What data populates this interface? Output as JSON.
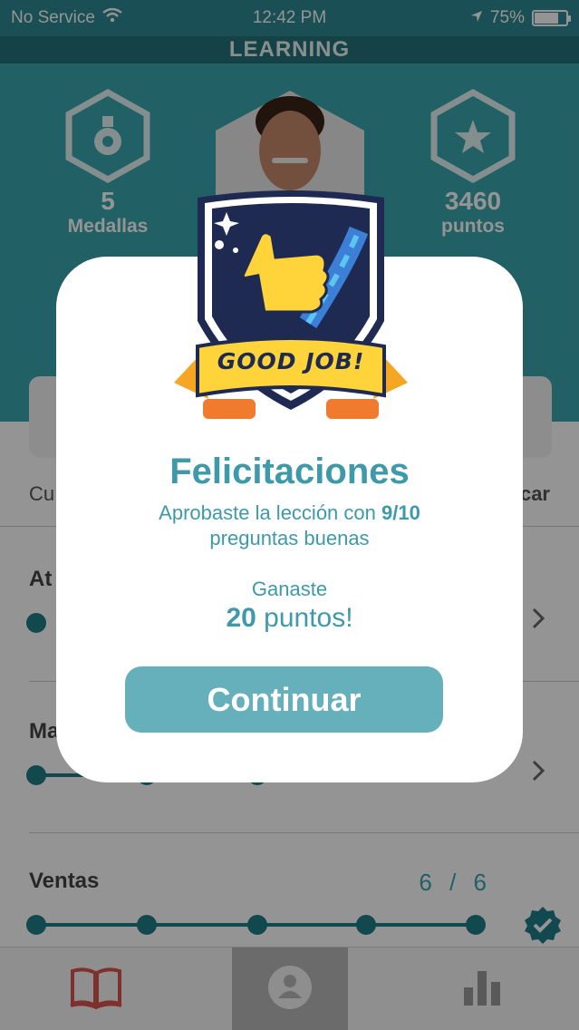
{
  "status_bar": {
    "carrier": "No Service",
    "time": "12:42 PM",
    "battery": "75%",
    "battery_level": 0.75
  },
  "app": {
    "title": "LEARNING"
  },
  "profile": {
    "medals": {
      "value": "5",
      "label": "Medallas",
      "icon": "medal-icon"
    },
    "points": {
      "value": "3460",
      "label": "puntos",
      "icon": "star-icon"
    }
  },
  "filter": {
    "left_label": "Cu",
    "right_label": "car"
  },
  "courses": [
    {
      "title": "At",
      "progress_done": "",
      "progress_sep": "",
      "progress_total": "",
      "completed_steps": 1
    },
    {
      "title": "Ma",
      "progress_done": "",
      "progress_sep": "",
      "progress_total": "",
      "completed_steps": 1
    },
    {
      "title": "Ventas",
      "progress_done": "6",
      "progress_sep": "/",
      "progress_total": "6",
      "completed_steps": 5
    }
  ],
  "tabs": [
    {
      "name": "book-icon"
    },
    {
      "name": "profile-icon"
    },
    {
      "name": "stats-icon"
    }
  ],
  "modal": {
    "badge_text": "GOOD JOB!",
    "title": "Felicitaciones",
    "msg_prefix": "Aprobaste la lección con ",
    "score": "9/10",
    "msg_line2": "preguntas buenas",
    "earned_label": "Ganaste",
    "points_value": "20",
    "points_suffix": " puntos!",
    "continue_label": "Continuar"
  },
  "colors": {
    "teal": "#3aa5af",
    "dark_teal": "#24737a",
    "modal_text": "#3e9aa8",
    "button": "#66b0bb",
    "book_red": "#d9534f"
  }
}
